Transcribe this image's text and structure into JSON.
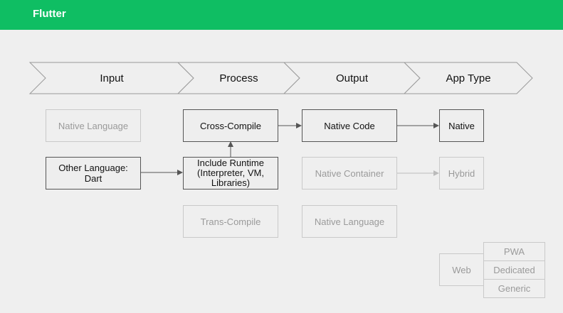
{
  "header": {
    "title": "Flutter"
  },
  "stages": [
    "Input",
    "Process",
    "Output",
    "App Type"
  ],
  "input": {
    "native_language": "Native Language",
    "other_language": "Other Language:\nDart"
  },
  "process": {
    "cross_compile": "Cross-Compile",
    "include_runtime": "Include Runtime\n(Interpreter, VM,\nLibraries)",
    "trans_compile": "Trans-Compile"
  },
  "output": {
    "native_code": "Native Code",
    "native_container": "Native Container",
    "native_language": "Native Language"
  },
  "app_type": {
    "native": "Native",
    "hybrid": "Hybrid",
    "web": "Web",
    "web_variants": [
      "PWA",
      "Dedicated",
      "Generic"
    ]
  },
  "colors": {
    "header": "#0fbe63",
    "active_border": "#555555",
    "inactive_border": "#c9c9c9",
    "active_text": "#111111",
    "inactive_text": "#9a9a9a",
    "background": "#efefef"
  }
}
